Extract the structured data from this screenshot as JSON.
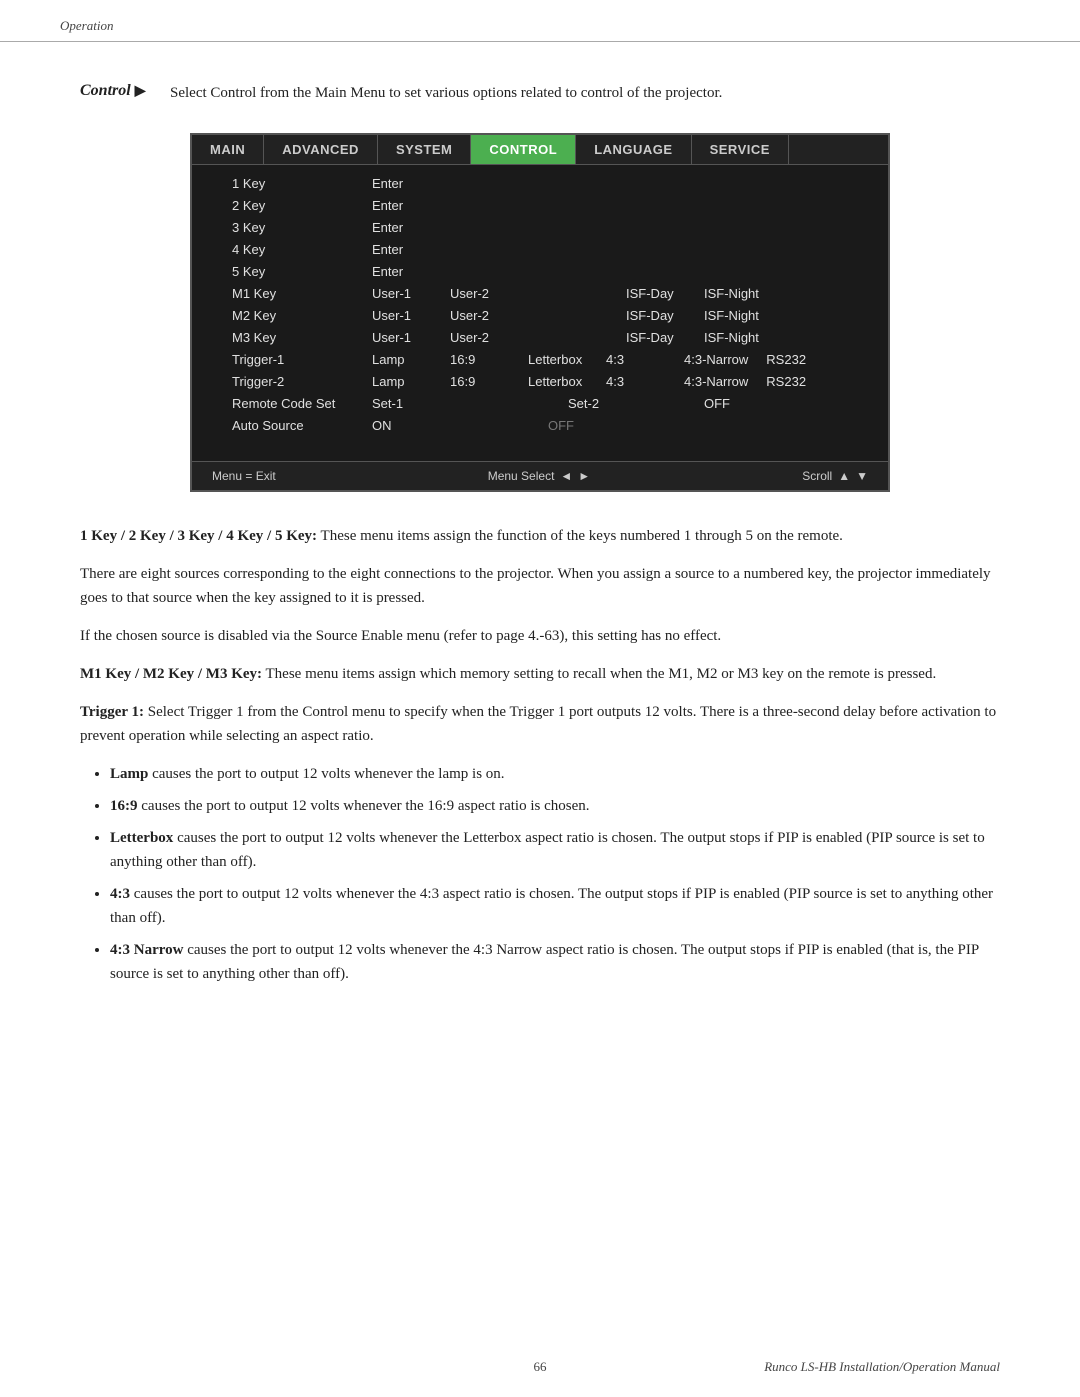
{
  "header": {
    "breadcrumb": "Operation"
  },
  "control_intro": {
    "label": "Control",
    "arrow": "▶",
    "description": "Select Control from the Main Menu to set various options related to control of the projector."
  },
  "menu": {
    "tabs": [
      {
        "label": "MAIN",
        "active": false
      },
      {
        "label": "ADVANCED",
        "active": false
      },
      {
        "label": "SYSTEM",
        "active": false
      },
      {
        "label": "CONTROL",
        "active": true
      },
      {
        "label": "LANGUAGE",
        "active": false
      },
      {
        "label": "SERVICE",
        "active": false
      }
    ],
    "rows": [
      {
        "label": "1 Key",
        "values": [
          "",
          "",
          "Enter",
          "",
          "",
          ""
        ]
      },
      {
        "label": "2 Key",
        "values": [
          "",
          "",
          "Enter",
          "",
          "",
          ""
        ]
      },
      {
        "label": "3 Key",
        "values": [
          "",
          "",
          "Enter",
          "",
          "",
          ""
        ]
      },
      {
        "label": "4 Key",
        "values": [
          "",
          "",
          "Enter",
          "",
          "",
          ""
        ]
      },
      {
        "label": "5 Key",
        "values": [
          "",
          "",
          "Enter",
          "",
          "",
          ""
        ]
      },
      {
        "label": "M1 Key",
        "values": [
          "",
          "User-1",
          "User-2",
          "",
          "ISF-Day",
          "ISF-Night"
        ]
      },
      {
        "label": "M2 Key",
        "values": [
          "",
          "User-1",
          "User-2",
          "",
          "ISF-Day",
          "ISF-Night"
        ]
      },
      {
        "label": "M3 Key",
        "values": [
          "",
          "User-1",
          "User-2",
          "",
          "ISF-Day",
          "ISF-Night"
        ]
      },
      {
        "label": "Trigger-1",
        "values": [
          "",
          "Lamp",
          "16:9",
          "Letterbox",
          "4:3",
          "4:3-Narrow",
          "RS232"
        ]
      },
      {
        "label": "Trigger-2",
        "values": [
          "",
          "Lamp",
          "16:9",
          "Letterbox",
          "4:3",
          "4:3-Narrow",
          "RS232"
        ]
      },
      {
        "label": "Remote Code Set",
        "values": [
          "",
          "Set-1",
          "",
          "Set-2",
          "",
          "OFF"
        ]
      },
      {
        "label": "Auto Source",
        "values": [
          "",
          "ON",
          "",
          "OFF",
          "",
          ""
        ]
      }
    ],
    "footer": {
      "menu_exit": "Menu = Exit",
      "menu_select": "Menu Select",
      "scroll": "Scroll"
    }
  },
  "body_text": {
    "keys_header": "1 Key / 2 Key / 3 Key / 4 Key / 5 Key:",
    "keys_desc": "These menu items assign the function of the keys numbered 1 through 5 on the remote.",
    "sources_para": "There are eight sources corresponding to the eight connections to the projector. When you assign a source to a numbered key, the projector immediately goes to that source when the key assigned to it is pressed.",
    "disabled_para": "If the chosen source is disabled via the Source Enable menu (refer to page 4.-63), this setting has no effect.",
    "m_keys_header": "M1 Key / M2 Key / M3 Key:",
    "m_keys_desc": "These menu items assign which memory setting to recall when the M1, M2 or M3 key on the remote is pressed.",
    "trigger1_header": "Trigger 1:",
    "trigger1_desc": "Select Trigger 1 from the Control menu to specify when the Trigger 1 port outputs 12 volts. There is a three-second delay before activation to prevent operation while selecting an aspect ratio.",
    "bullets": [
      {
        "bold": "Lamp",
        "text": " causes the port to output 12 volts whenever the lamp is on."
      },
      {
        "bold": "16:9",
        "text": " causes the port to output 12 volts whenever the 16:9 aspect ratio is chosen."
      },
      {
        "bold": "Letterbox",
        "text": " causes the port to output 12 volts whenever the Letterbox aspect ratio is chosen. The output stops if PIP is enabled (PIP source is set to anything other than off)."
      },
      {
        "bold": "4:3",
        "text": " causes the port to output 12 volts whenever the 4:3 aspect ratio is chosen. The output stops if PIP is enabled (PIP source is set to anything other than off)."
      },
      {
        "bold": "4:3 Narrow",
        "text": " causes the port to output 12 volts whenever the 4:3 Narrow aspect ratio is chosen.  The output stops if PIP is enabled (that is, the PIP source is set to anything other than off)."
      }
    ]
  },
  "footer": {
    "page_number": "66",
    "manual_name": "Runco LS-HB Installation/Operation Manual"
  }
}
